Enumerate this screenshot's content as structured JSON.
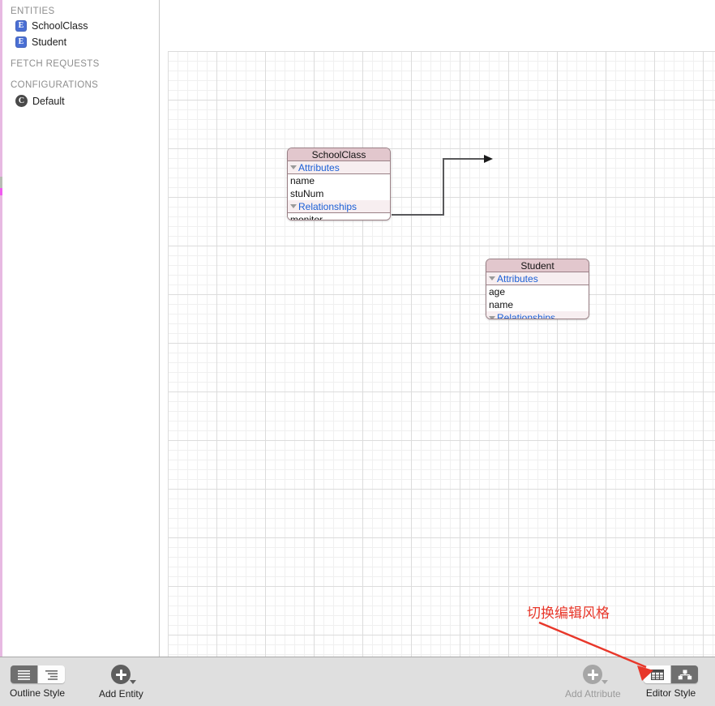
{
  "sidebar": {
    "sections": [
      {
        "title": "ENTITIES",
        "items": [
          {
            "label": "SchoolClass",
            "icon": "entity-badge-icon",
            "badge": "E"
          },
          {
            "label": "Student",
            "icon": "entity-badge-icon",
            "badge": "E"
          }
        ]
      },
      {
        "title": "FETCH REQUESTS",
        "items": []
      },
      {
        "title": "CONFIGURATIONS",
        "items": [
          {
            "label": "Default",
            "icon": "configuration-badge-icon",
            "badge": "C"
          }
        ]
      }
    ]
  },
  "canvas": {
    "entities": [
      {
        "name": "SchoolClass",
        "attributes_label": "Attributes",
        "attributes": [
          "name",
          "stuNum"
        ],
        "relationships_label": "Relationships",
        "relationships": [
          "monitor"
        ]
      },
      {
        "name": "Student",
        "attributes_label": "Attributes",
        "attributes": [
          "age",
          "name"
        ],
        "relationships_label": "Relationships",
        "relationships": []
      }
    ]
  },
  "annotation": {
    "text": "切换编辑风格",
    "color": "#e8372a"
  },
  "toolbar": {
    "outline_style": {
      "label": "Outline Style",
      "options": [
        "flat-list-icon",
        "hierarchy-list-icon"
      ],
      "selected_index": 0
    },
    "add_entity": {
      "label": "Add Entity",
      "icon": "plus-circle-icon",
      "enabled": true
    },
    "add_attribute": {
      "label": "Add Attribute",
      "icon": "plus-circle-icon",
      "enabled": false
    },
    "editor_style": {
      "label": "Editor Style",
      "options": [
        "table-editor-icon",
        "graph-editor-icon"
      ],
      "selected_index": 1
    }
  },
  "colors": {
    "entity_header": "#e2c7cd",
    "entity_section": "#f7eef0",
    "entity_border": "#9a8086",
    "section_text": "#1b5fd6",
    "badge_entity": "#4a6fd4",
    "badge_config": "#4a4a4a",
    "toolbar_bg": "#dfdfdf",
    "annotation": "#e8372a"
  }
}
